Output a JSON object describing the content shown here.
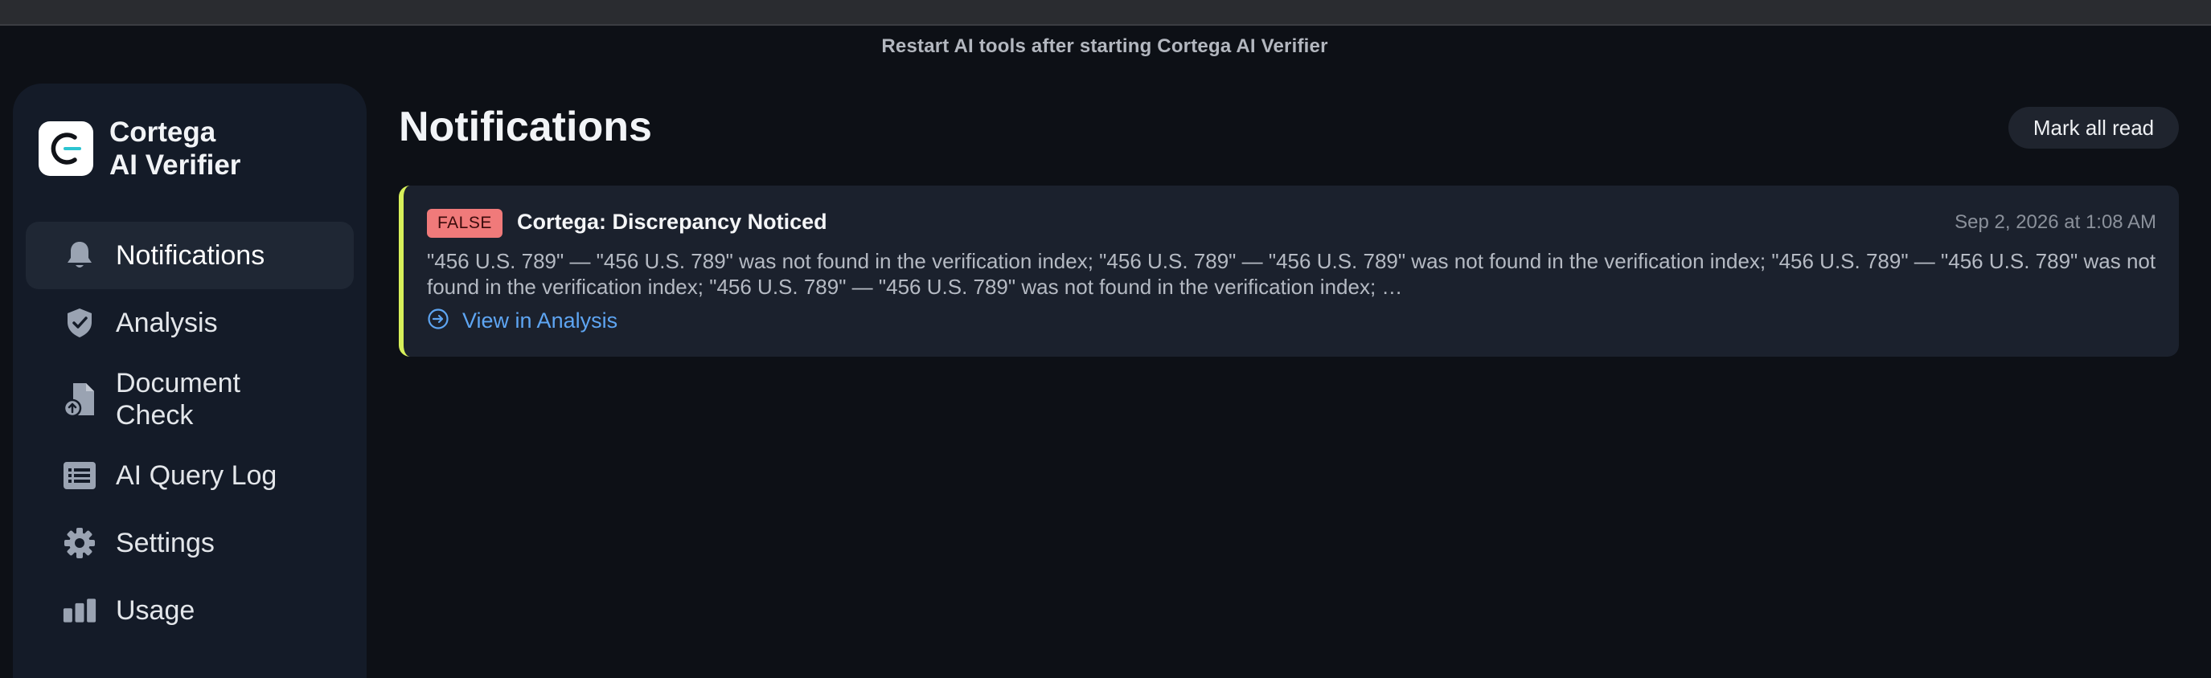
{
  "banner": {
    "text": "Restart AI tools after starting Cortega AI Verifier"
  },
  "brand": {
    "line1": "Cortega",
    "line2": "AI Verifier",
    "logo_icon": "cortega-logo-icon"
  },
  "sidebar": {
    "items": [
      {
        "label": "Notifications",
        "icon": "bell-icon",
        "active": true
      },
      {
        "label": "Analysis",
        "icon": "shield-check-icon",
        "active": false
      },
      {
        "label": "Document Check",
        "icon": "document-upload-icon",
        "active": false
      },
      {
        "label": "AI Query Log",
        "icon": "list-icon",
        "active": false
      },
      {
        "label": "Settings",
        "icon": "gear-icon",
        "active": false
      },
      {
        "label": "Usage",
        "icon": "bar-chart-icon",
        "active": false
      }
    ]
  },
  "main": {
    "title": "Notifications",
    "mark_all_read_label": "Mark all read",
    "notifications": [
      {
        "badge": "FALSE",
        "title": "Cortega: Discrepancy Noticed",
        "time": "Sep 2, 2026 at 1:08 AM",
        "body": "\"456 U.S. 789\" — \"456 U.S. 789\" was not found in the verification index; \"456 U.S. 789\" — \"456 U.S. 789\" was not found in the verification index; \"456 U.S. 789\" — \"456 U.S. 789\" was not found in the verification index; \"456 U.S. 789\" — \"456 U.S. 789\" was not found in the verification index; …",
        "link_label": "View in Analysis",
        "link_icon": "arrow-circle-right-icon"
      }
    ]
  },
  "colors": {
    "background": "#0d1016",
    "sidebar": "#141b28",
    "card": "#1b212d",
    "card_accent": "#d7f05a",
    "badge_false": "#f07a7a",
    "link": "#5ea5f2"
  }
}
